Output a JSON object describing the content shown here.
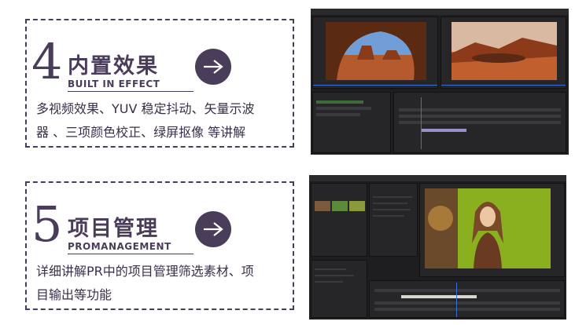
{
  "features": [
    {
      "number": "4",
      "title_cn": "内置效果",
      "title_en": "BUILT IN EFFECT",
      "desc_line1": "多视频效果、YUV 稳定抖动、矢量示波",
      "desc_line2": "器 、三项颜色校正、绿屏抠像 等讲解"
    },
    {
      "number": "5",
      "title_cn": "项目管理",
      "title_en": "PROMANAGEMENT",
      "desc_line1": "详细讲解PR中的项目管理筛选素材、项",
      "desc_line2": "目输出等功能"
    }
  ],
  "icons": {
    "arrow": "arrow-right-icon"
  },
  "colors": {
    "accent": "#4a3d5a",
    "editor_bg": "#1e1e20",
    "clip_purple": "#9c8fc9",
    "clip_white": "#d8d6cf",
    "playhead": "#3b6fd8"
  }
}
